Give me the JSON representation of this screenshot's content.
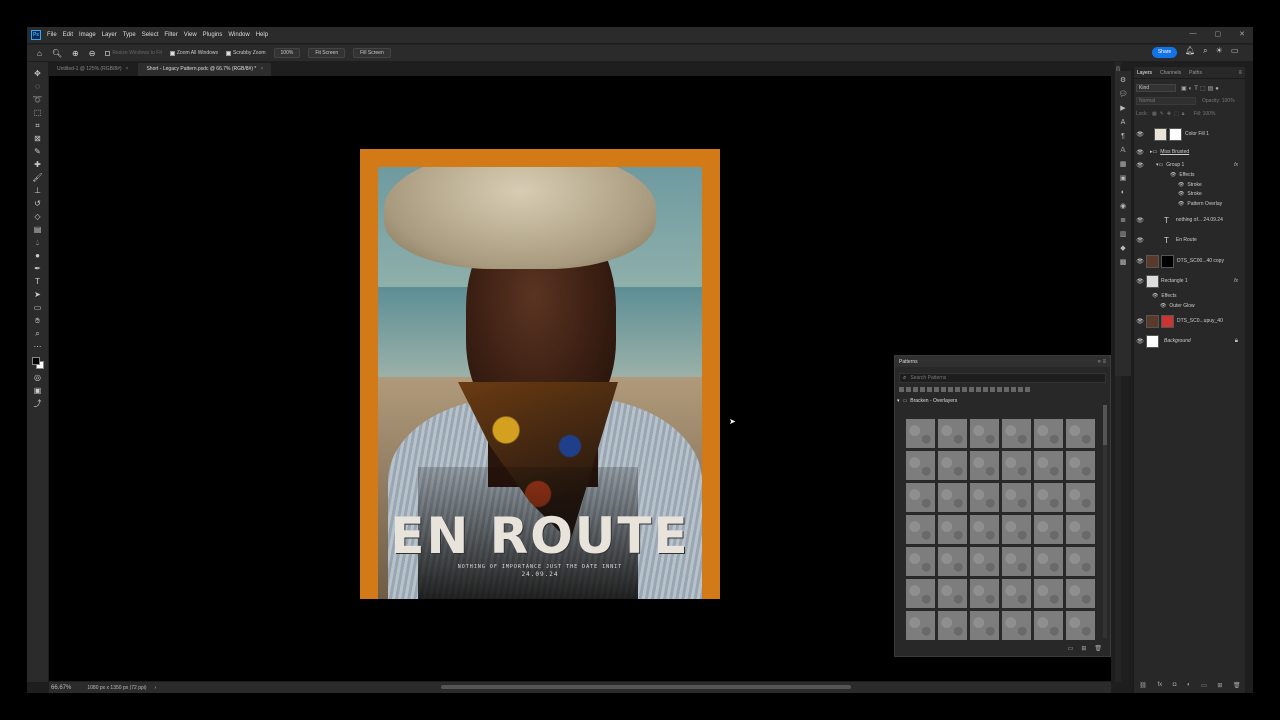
{
  "app": {
    "logo": "Ps"
  },
  "menu": [
    "File",
    "Edit",
    "Image",
    "Layer",
    "Type",
    "Select",
    "Filter",
    "View",
    "Plugins",
    "Window",
    "Help"
  ],
  "options": {
    "resize": "Resize Windows to Fit",
    "zoom_all": "Zoom All Windows",
    "scrubby": "Scrubby Zoom",
    "zoom_value": "100%",
    "fit_screen": "Fit Screen",
    "fill_screen": "Fill Screen",
    "share": "Share"
  },
  "tabs": [
    {
      "label": "Untitled-1 @ 125% (RGB/8#)"
    },
    {
      "label": "Short - Legacy Pattern.psdc @ 66.7% (RGB/8#) *"
    }
  ],
  "poster": {
    "title": "EN ROUTE",
    "subtitle": "NOTHING OF IMPORTANCE JUST THE DATE INNIT",
    "date": "24.09.24"
  },
  "status": {
    "zoom": "66.67%",
    "doc": "1080 px x 1350 px (72 ppi)"
  },
  "layers_panel": {
    "tabs": [
      "Layers",
      "Channels",
      "Paths"
    ],
    "kind": "Kind",
    "blend": "Normal",
    "opacity": "Opacity: 100%",
    "lock": "Lock:",
    "fill": "Fill: 100%",
    "items": [
      {
        "name": "Color Fill 1"
      },
      {
        "name": "Miss Brusted"
      },
      {
        "name": "Group 1"
      },
      {
        "name": "Effects"
      },
      {
        "name": "Stroke"
      },
      {
        "name": "Stroke"
      },
      {
        "name": "Pattern Overlay"
      },
      {
        "name": "nothing of... 24.09.24"
      },
      {
        "name": "En Route"
      },
      {
        "name": "DTS_SC00...40 copy"
      },
      {
        "name": "Rectangle 1"
      },
      {
        "name": "Effects"
      },
      {
        "name": "Outer Glow"
      },
      {
        "name": "DTS_SC0...upuy_40"
      },
      {
        "name": "Background"
      }
    ]
  },
  "patterns_panel": {
    "title": "Patterns",
    "search_placeholder": "Search Patterns",
    "group": "Bracken - Overlayers"
  }
}
